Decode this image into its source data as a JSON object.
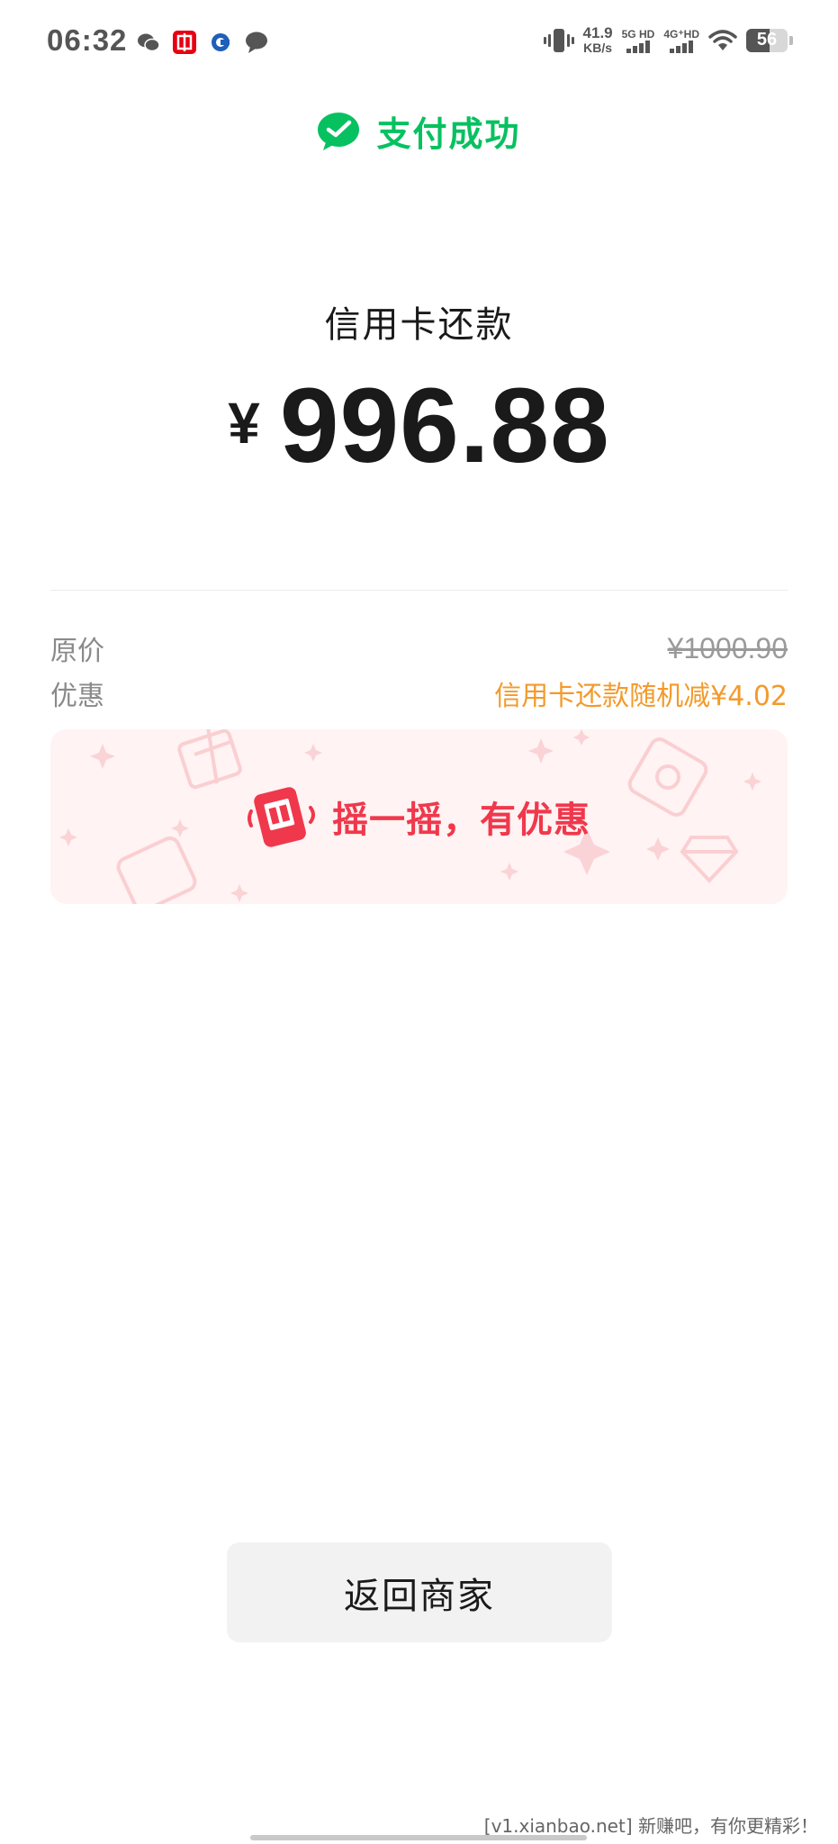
{
  "status_bar": {
    "time": "06:32",
    "speed_value": "41.9",
    "speed_unit": "KB/s",
    "net1": "5G HD",
    "net2": "4G⁺HD",
    "battery": "56",
    "battery_level": 0.56,
    "icons": [
      "wechat-icon",
      "citic-bank-icon",
      "bank-app-icon",
      "message-icon",
      "vibrate-icon",
      "wifi-icon"
    ]
  },
  "header": {
    "title": "支付成功",
    "icon": "wechat-pay-check-icon",
    "accent": "#07c160"
  },
  "payment": {
    "merchant": "信用卡还款",
    "currency": "¥",
    "amount": "996.88"
  },
  "details": {
    "original_label": "原价",
    "original_value": "¥1000.90",
    "discount_label": "优惠",
    "discount_value": "信用卡还款随机减¥4.02",
    "discount_color": "#f39a2b"
  },
  "banner": {
    "text": "摇一摇，有优惠",
    "icon": "shake-phone-icon",
    "color": "#f0384c"
  },
  "actions": {
    "return_label": "返回商家"
  },
  "watermark": "[v1.xianbao.net] 新赚吧，有你更精彩！"
}
